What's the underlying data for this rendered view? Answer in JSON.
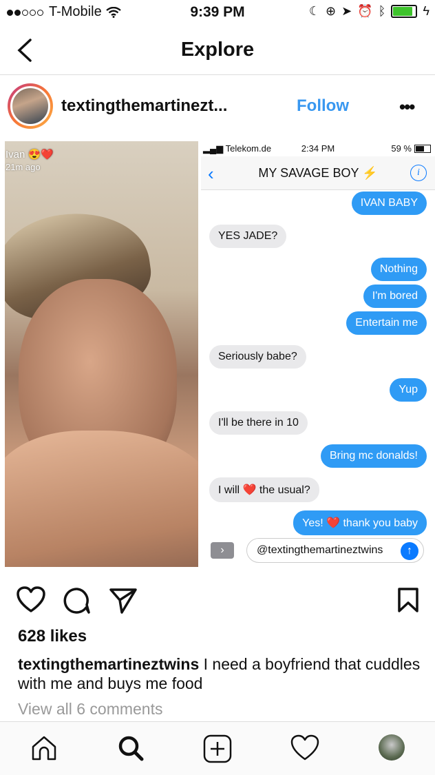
{
  "status_bar": {
    "carrier": "T-Mobile",
    "time": "9:39 PM"
  },
  "nav": {
    "title": "Explore"
  },
  "post": {
    "username": "textingthemartinezt...",
    "follow_label": "Follow",
    "more_label": "•••",
    "snap": {
      "name": "Ivan 😍❤️",
      "time": "21m ago"
    },
    "messages_screen": {
      "carrier": "Telekom.de",
      "time": "2:34 PM",
      "battery": "59 %",
      "title": "MY SAVAGE BOY",
      "title_emoji": "⚡",
      "messages": [
        {
          "dir": "out",
          "text": "IVAN BABY"
        },
        {
          "dir": "in",
          "text": "YES JADE?"
        },
        {
          "dir": "out",
          "text": "Nothing"
        },
        {
          "dir": "out",
          "text": "I'm bored"
        },
        {
          "dir": "out",
          "text": "Entertain me"
        },
        {
          "dir": "in",
          "text": "Seriously babe?"
        },
        {
          "dir": "out",
          "text": "Yup"
        },
        {
          "dir": "in",
          "text": "I'll be there in 10"
        },
        {
          "dir": "out",
          "text": "Bring mc donalds!"
        },
        {
          "dir": "in",
          "text": "I will ❤️ the usual?"
        },
        {
          "dir": "out",
          "text": "Yes! ❤️ thank you baby"
        }
      ],
      "input_text": "@textingthemartineztwins"
    },
    "likes": "628 likes",
    "caption_user": "textingthemartineztwins",
    "caption_text": " I need a boyfriend that cuddles with me and buys me food",
    "view_comments": "View all 6 comments"
  },
  "tabs": [
    "home-icon",
    "search-icon",
    "add-icon",
    "heart-icon",
    "profile-avatar"
  ],
  "colors": {
    "accent": "#3897f0",
    "imessage_blue": "#2f9bf5",
    "received_gray": "#e9e9eb"
  }
}
